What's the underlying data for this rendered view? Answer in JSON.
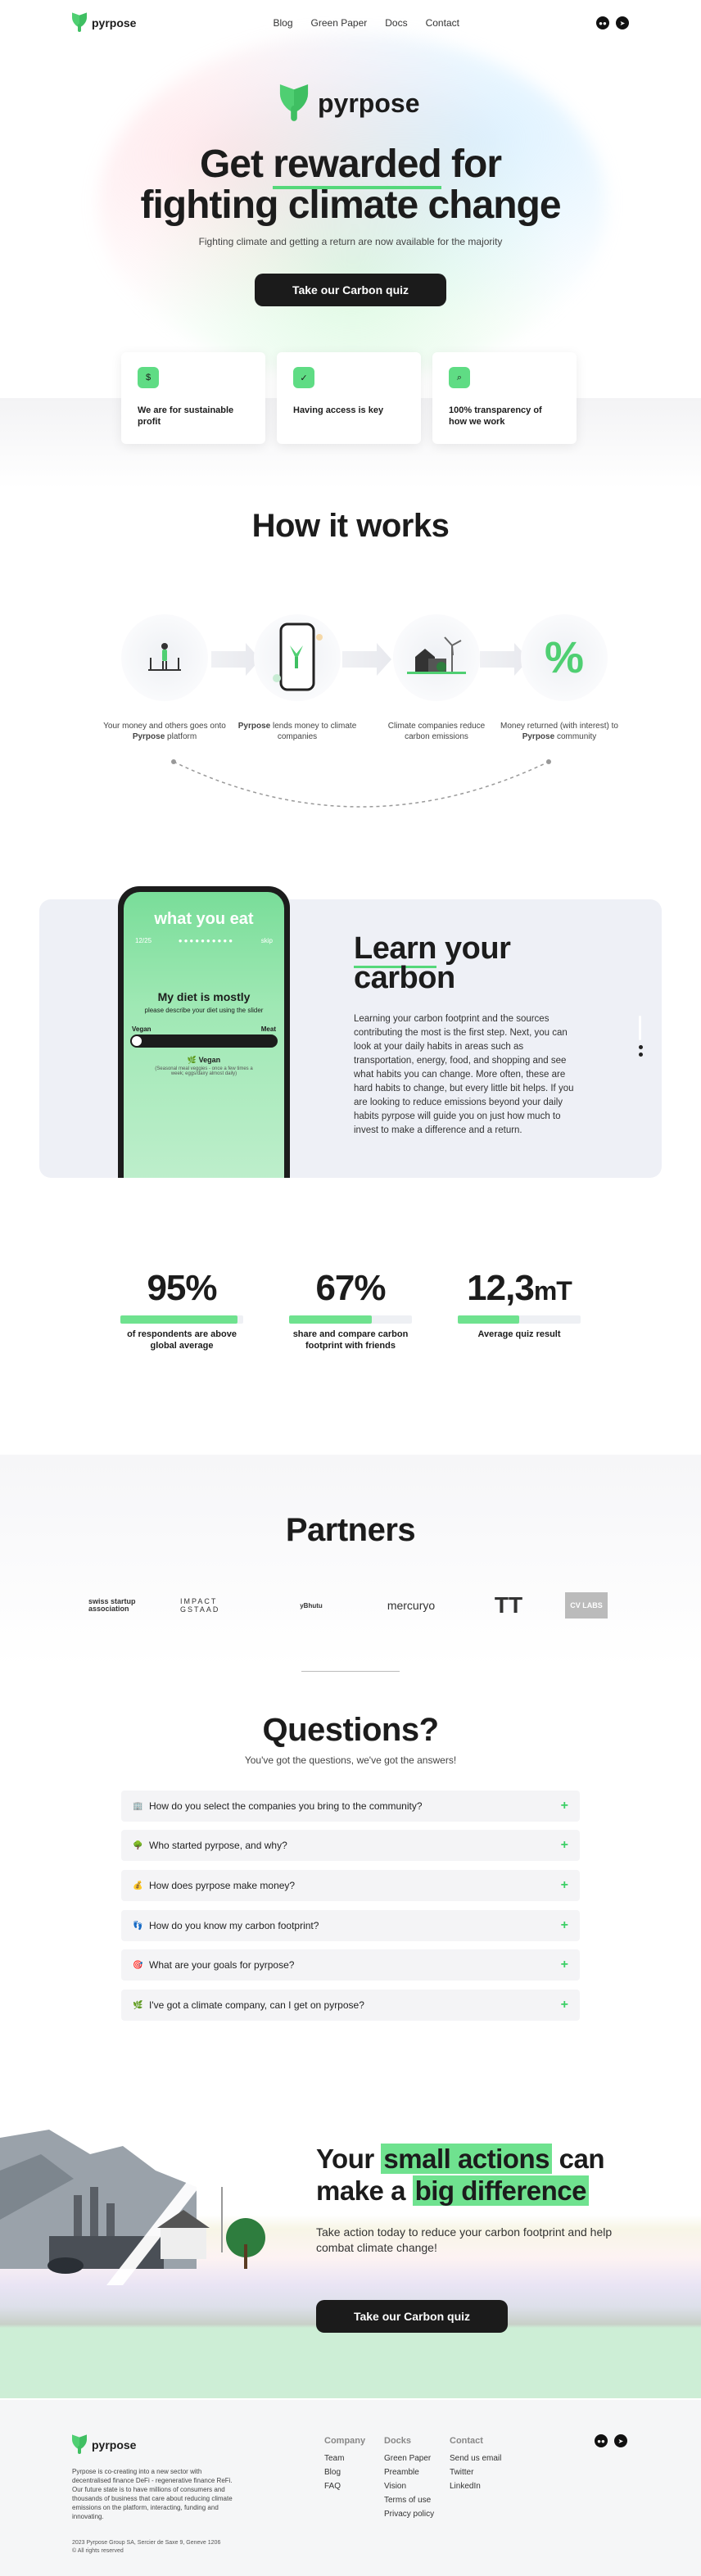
{
  "nav": {
    "brand": "pyrpose",
    "links": [
      "Blog",
      "Green Paper",
      "Docs",
      "Contact"
    ],
    "socials": [
      "medium-icon",
      "telegram-icon"
    ]
  },
  "hero": {
    "brand": "pyrpose",
    "title_pre": "Get ",
    "title_highlight": "rewarded",
    "title_post": " for",
    "title_line2": "fighting climate change",
    "subtitle": "Fighting climate and getting a return are now available for the majority",
    "button": "Take our Carbon quiz"
  },
  "features": [
    {
      "icon": "money-bag-icon",
      "glyph": "$",
      "text": "We are for sustainable profit"
    },
    {
      "icon": "check-circle-icon",
      "glyph": "✓",
      "text": "Having access is key"
    },
    {
      "icon": "search-icon",
      "glyph": "⌕",
      "text": "100% transparency of how we work"
    }
  ],
  "how": {
    "title": "How it works",
    "steps": [
      {
        "icon": "person-platform-icon",
        "pre": "Your money and others goes onto ",
        "bold": "Pyrpose",
        "post": " platform"
      },
      {
        "icon": "phone-leaf-icon",
        "pre": "",
        "bold": "Pyrpose",
        "post": " lends money to climate companies"
      },
      {
        "icon": "house-windmill-icon",
        "pre": "Climate companies reduce carbon emissions",
        "bold": "",
        "post": ""
      },
      {
        "icon": "percent-icon",
        "pre": "Money returned (with interest) to ",
        "bold": "Pyrpose",
        "post": " community"
      }
    ]
  },
  "learn": {
    "title_highlight": "Learn",
    "title_rest": " your",
    "title_line2": "carbon",
    "body": "Learning your carbon footprint and the sources contributing the most is the first step. Next, you can look at your daily habits in areas such as transportation, energy, food, and shopping and see what habits you can change. More often, these are hard habits to change, but every little bit helps. If you are looking to reduce emissions beyond your daily habits pyrpose will guide you on just how much to invest to make a difference and a return.",
    "phone": {
      "header": "what you eat",
      "progress_left": "12/25",
      "skip": "skip",
      "question": "My diet is mostly",
      "hint": "please describe your diet using the slider",
      "left_label": "Vegan",
      "right_label": "Meat",
      "answer": "Vegan",
      "answer_desc": "(Seasonal meal veggies - once a few times a week; eggs/dairy almost daily)"
    }
  },
  "stats": [
    {
      "value": "95%",
      "fraction": 0.95,
      "label": "of respondents are above global average"
    },
    {
      "value": "67%",
      "fraction": 0.67,
      "label": "share and compare carbon footprint with friends"
    },
    {
      "value": "12,3",
      "unit": "mT",
      "fraction": 0.5,
      "label": "Average quiz result"
    }
  ],
  "partners": {
    "title": "Partners",
    "logos": [
      "swiss startup association",
      "IMPACT GSTAAD",
      "yBhutu",
      "mercuryo",
      "TT",
      "CV LABS"
    ]
  },
  "faq": {
    "title": "Questions?",
    "subtitle": "You've got the questions, we've got the answers!",
    "items": [
      {
        "emoji": "🏢",
        "q": "How do you select the companies you bring to the community?"
      },
      {
        "emoji": "🌳",
        "q": "Who started pyrpose, and why?"
      },
      {
        "emoji": "💰",
        "q": "How does pyrpose make money?"
      },
      {
        "emoji": "👣",
        "q": "How do you know my carbon footprint?"
      },
      {
        "emoji": "🎯",
        "q": "What are your goals for pyrpose?"
      },
      {
        "emoji": "🌿",
        "q": "I've got a climate company, can I get on pyrpose?"
      }
    ],
    "plus": "+"
  },
  "cta": {
    "line1_pre": "Your ",
    "line1_highlight": "small actions",
    "line1_post": " can",
    "line2_pre": "make a ",
    "line2_highlight": "big difference",
    "subtitle": "Take action today to reduce your carbon footprint and help combat climate change!",
    "button": "Take our Carbon quiz"
  },
  "footer": {
    "brand": "pyrpose",
    "description": "Pyrpose is co-creating into a new sector with decentralised finance DeFi - regenerative finance ReFi. Our future state is to have millions of consumers and thousands of business that care about reducing climate emissions on the platform, interacting, funding and innovating.",
    "copyright": "2023 Pyrpose Group SA, Sercier de Saxe 9, Geneve 1206",
    "rights": "© All rights reserved",
    "columns": [
      {
        "title": "Company",
        "links": [
          "Team",
          "Blog",
          "FAQ"
        ]
      },
      {
        "title": "Docks",
        "links": [
          "Green Paper",
          "Preamble",
          "Vision",
          "Terms of use",
          "Privacy policy"
        ]
      },
      {
        "title": "Contact",
        "links": [
          "Send us email",
          "Twitter",
          "LinkedIn"
        ]
      }
    ]
  },
  "colors": {
    "accent": "#6fe28f",
    "dark": "#1b1b1b",
    "card_bg": "#eef0f6"
  }
}
